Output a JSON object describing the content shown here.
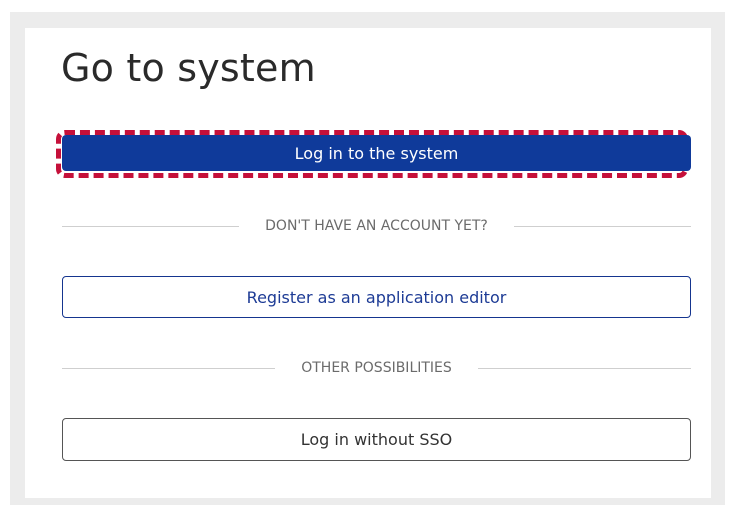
{
  "page": {
    "title": "Go to system"
  },
  "actions": {
    "login_label": "Log in to the system",
    "register_label": "Register as an application editor",
    "login_without_sso_label": "Log in without SSO"
  },
  "dividers": {
    "no_account": "DON'T HAVE AN ACCOUNT YET?",
    "other": "OTHER POSSIBILITIES"
  },
  "colors": {
    "primary": "#0f3a9a",
    "highlight": "#c5103a",
    "outline_blue": "#15358f"
  }
}
